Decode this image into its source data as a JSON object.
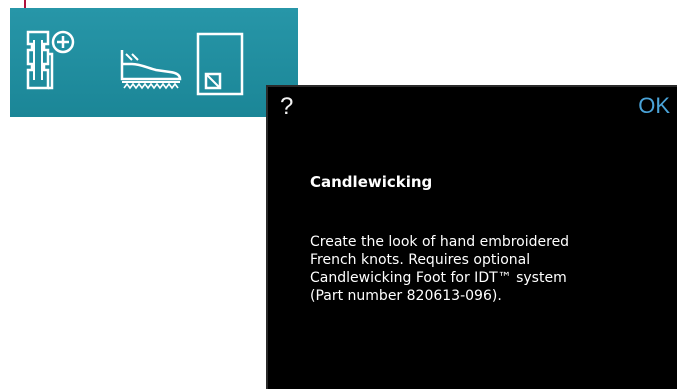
{
  "toolbar": {
    "accent_color": "#1f8fa1",
    "tools": [
      {
        "icon": "hoop-add-icon"
      },
      {
        "icon": "presser-foot-icon"
      },
      {
        "icon": "page-icon"
      }
    ]
  },
  "dialog": {
    "help_label": "?",
    "ok_label": "OK",
    "title": "Candlewicking",
    "body_lines": [
      "Create the look of hand embroidered",
      "French knots. Requires optional",
      "Candlewicking Foot for IDT™ system",
      "(Part number 820613-096)."
    ]
  }
}
